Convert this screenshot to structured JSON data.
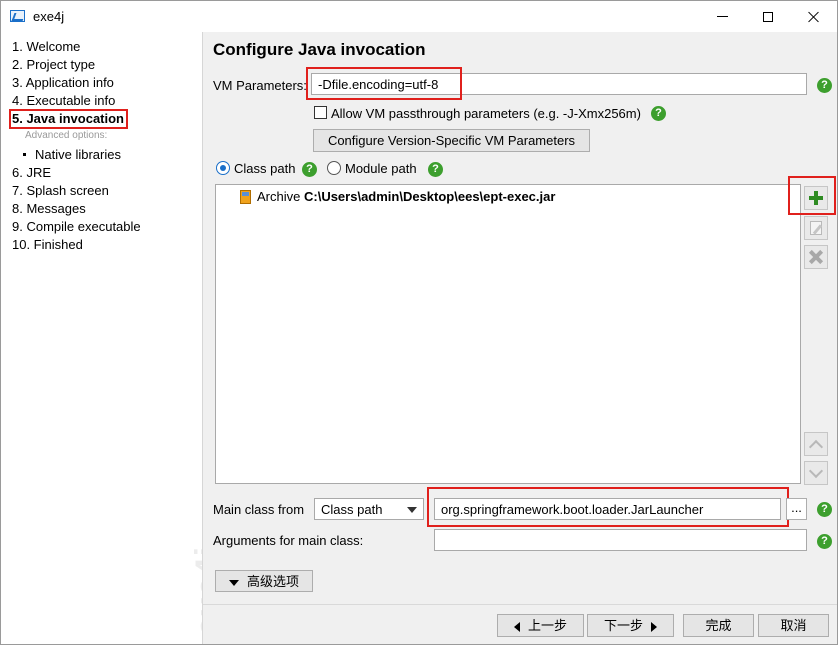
{
  "window": {
    "title": "exe4j",
    "icon": "exe4j-app-icon"
  },
  "sidebar": {
    "steps": [
      {
        "label": "1. Welcome"
      },
      {
        "label": "2. Project type"
      },
      {
        "label": "3. Application info"
      },
      {
        "label": "4. Executable info"
      },
      {
        "label": "5. Java invocation",
        "active": true
      },
      {
        "label": "6. JRE"
      },
      {
        "label": "7. Splash screen"
      },
      {
        "label": "8. Messages"
      },
      {
        "label": "9. Compile executable"
      },
      {
        "label": "10. Finished"
      }
    ],
    "advanced_label": "Advanced options:",
    "sub_steps": [
      {
        "label": "Native libraries"
      }
    ],
    "watermark": "exe4j"
  },
  "main": {
    "title": "Configure Java invocation",
    "vm_params": {
      "label": "VM Parameters:",
      "value": "-Dfile.encoding=utf-8"
    },
    "passthrough": {
      "label": "Allow VM passthrough parameters (e.g. -J-Xmx256m)",
      "checked": false
    },
    "version_specific_button": "Configure Version-Specific VM Parameters",
    "path_mode": {
      "class_path": "Class path",
      "module_path": "Module path",
      "selected": "class_path"
    },
    "classpath_entries": [
      {
        "prefix": "Archive",
        "path": "C:\\Users\\admin\\Desktop\\ees\\ept-exec.jar"
      }
    ],
    "main_class": {
      "label": "Main class from",
      "source": "Class path",
      "value": "org.springframework.boot.loader.JarLauncher",
      "browse_label": "..."
    },
    "arguments": {
      "label": "Arguments for main class:",
      "value": ""
    },
    "advanced_button": "高级选项"
  },
  "footer": {
    "back": "上一步",
    "next": "下一步",
    "finish": "完成",
    "cancel": "取消"
  },
  "colors": {
    "highlight": "#e0201c",
    "help": "#3d9f2e",
    "add": "#2e8b22",
    "radio": "#1a6fc9"
  }
}
